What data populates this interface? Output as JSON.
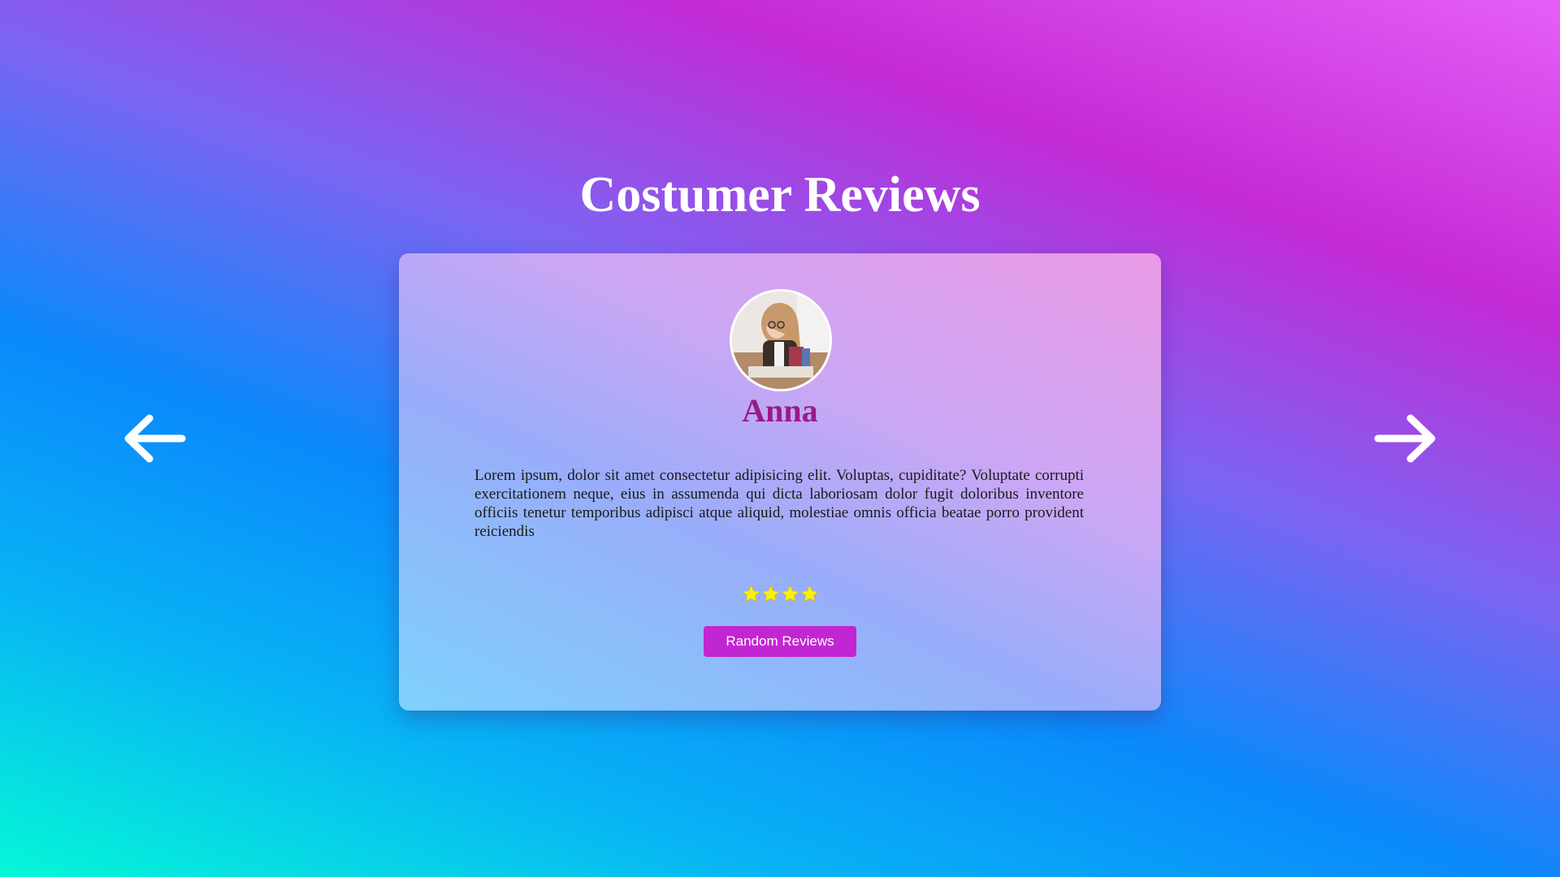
{
  "page": {
    "title": "Costumer Reviews"
  },
  "navigation": {
    "prev_icon": "arrow-left-icon",
    "next_icon": "arrow-right-icon"
  },
  "review": {
    "avatar_icon": "user-photo",
    "name": "Anna",
    "text": "Lorem ipsum, dolor sit amet consectetur adipisicing elit. Voluptas, cupiditate? Voluptate corrupti exercitationem neque, eius in assumenda qui dicta laboriosam dolor fugit doloribus inventore officiis tenetur temporibus adipisci atque aliquid, molestiae omnis officia beatae porro provident reiciendis",
    "rating": 4,
    "star_icon": "star-icon",
    "star_color": "#f7f20a"
  },
  "actions": {
    "random_label": "Random Reviews"
  },
  "colors": {
    "accent": "#c226d2",
    "name_color": "#9b1a86",
    "title_color": "#ffffff"
  }
}
